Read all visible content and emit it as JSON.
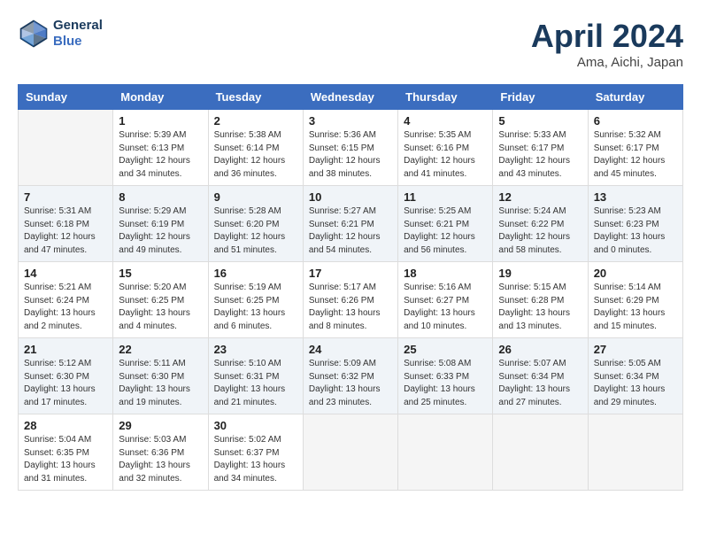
{
  "header": {
    "logo_line1": "General",
    "logo_line2": "Blue",
    "title": "April 2024",
    "location": "Ama, Aichi, Japan"
  },
  "weekdays": [
    "Sunday",
    "Monday",
    "Tuesday",
    "Wednesday",
    "Thursday",
    "Friday",
    "Saturday"
  ],
  "weeks": [
    [
      {
        "day": "",
        "sunrise": "",
        "sunset": "",
        "daylight": ""
      },
      {
        "day": "1",
        "sunrise": "Sunrise: 5:39 AM",
        "sunset": "Sunset: 6:13 PM",
        "daylight": "Daylight: 12 hours and 34 minutes."
      },
      {
        "day": "2",
        "sunrise": "Sunrise: 5:38 AM",
        "sunset": "Sunset: 6:14 PM",
        "daylight": "Daylight: 12 hours and 36 minutes."
      },
      {
        "day": "3",
        "sunrise": "Sunrise: 5:36 AM",
        "sunset": "Sunset: 6:15 PM",
        "daylight": "Daylight: 12 hours and 38 minutes."
      },
      {
        "day": "4",
        "sunrise": "Sunrise: 5:35 AM",
        "sunset": "Sunset: 6:16 PM",
        "daylight": "Daylight: 12 hours and 41 minutes."
      },
      {
        "day": "5",
        "sunrise": "Sunrise: 5:33 AM",
        "sunset": "Sunset: 6:17 PM",
        "daylight": "Daylight: 12 hours and 43 minutes."
      },
      {
        "day": "6",
        "sunrise": "Sunrise: 5:32 AM",
        "sunset": "Sunset: 6:17 PM",
        "daylight": "Daylight: 12 hours and 45 minutes."
      }
    ],
    [
      {
        "day": "7",
        "sunrise": "Sunrise: 5:31 AM",
        "sunset": "Sunset: 6:18 PM",
        "daylight": "Daylight: 12 hours and 47 minutes."
      },
      {
        "day": "8",
        "sunrise": "Sunrise: 5:29 AM",
        "sunset": "Sunset: 6:19 PM",
        "daylight": "Daylight: 12 hours and 49 minutes."
      },
      {
        "day": "9",
        "sunrise": "Sunrise: 5:28 AM",
        "sunset": "Sunset: 6:20 PM",
        "daylight": "Daylight: 12 hours and 51 minutes."
      },
      {
        "day": "10",
        "sunrise": "Sunrise: 5:27 AM",
        "sunset": "Sunset: 6:21 PM",
        "daylight": "Daylight: 12 hours and 54 minutes."
      },
      {
        "day": "11",
        "sunrise": "Sunrise: 5:25 AM",
        "sunset": "Sunset: 6:21 PM",
        "daylight": "Daylight: 12 hours and 56 minutes."
      },
      {
        "day": "12",
        "sunrise": "Sunrise: 5:24 AM",
        "sunset": "Sunset: 6:22 PM",
        "daylight": "Daylight: 12 hours and 58 minutes."
      },
      {
        "day": "13",
        "sunrise": "Sunrise: 5:23 AM",
        "sunset": "Sunset: 6:23 PM",
        "daylight": "Daylight: 13 hours and 0 minutes."
      }
    ],
    [
      {
        "day": "14",
        "sunrise": "Sunrise: 5:21 AM",
        "sunset": "Sunset: 6:24 PM",
        "daylight": "Daylight: 13 hours and 2 minutes."
      },
      {
        "day": "15",
        "sunrise": "Sunrise: 5:20 AM",
        "sunset": "Sunset: 6:25 PM",
        "daylight": "Daylight: 13 hours and 4 minutes."
      },
      {
        "day": "16",
        "sunrise": "Sunrise: 5:19 AM",
        "sunset": "Sunset: 6:25 PM",
        "daylight": "Daylight: 13 hours and 6 minutes."
      },
      {
        "day": "17",
        "sunrise": "Sunrise: 5:17 AM",
        "sunset": "Sunset: 6:26 PM",
        "daylight": "Daylight: 13 hours and 8 minutes."
      },
      {
        "day": "18",
        "sunrise": "Sunrise: 5:16 AM",
        "sunset": "Sunset: 6:27 PM",
        "daylight": "Daylight: 13 hours and 10 minutes."
      },
      {
        "day": "19",
        "sunrise": "Sunrise: 5:15 AM",
        "sunset": "Sunset: 6:28 PM",
        "daylight": "Daylight: 13 hours and 13 minutes."
      },
      {
        "day": "20",
        "sunrise": "Sunrise: 5:14 AM",
        "sunset": "Sunset: 6:29 PM",
        "daylight": "Daylight: 13 hours and 15 minutes."
      }
    ],
    [
      {
        "day": "21",
        "sunrise": "Sunrise: 5:12 AM",
        "sunset": "Sunset: 6:30 PM",
        "daylight": "Daylight: 13 hours and 17 minutes."
      },
      {
        "day": "22",
        "sunrise": "Sunrise: 5:11 AM",
        "sunset": "Sunset: 6:30 PM",
        "daylight": "Daylight: 13 hours and 19 minutes."
      },
      {
        "day": "23",
        "sunrise": "Sunrise: 5:10 AM",
        "sunset": "Sunset: 6:31 PM",
        "daylight": "Daylight: 13 hours and 21 minutes."
      },
      {
        "day": "24",
        "sunrise": "Sunrise: 5:09 AM",
        "sunset": "Sunset: 6:32 PM",
        "daylight": "Daylight: 13 hours and 23 minutes."
      },
      {
        "day": "25",
        "sunrise": "Sunrise: 5:08 AM",
        "sunset": "Sunset: 6:33 PM",
        "daylight": "Daylight: 13 hours and 25 minutes."
      },
      {
        "day": "26",
        "sunrise": "Sunrise: 5:07 AM",
        "sunset": "Sunset: 6:34 PM",
        "daylight": "Daylight: 13 hours and 27 minutes."
      },
      {
        "day": "27",
        "sunrise": "Sunrise: 5:05 AM",
        "sunset": "Sunset: 6:34 PM",
        "daylight": "Daylight: 13 hours and 29 minutes."
      }
    ],
    [
      {
        "day": "28",
        "sunrise": "Sunrise: 5:04 AM",
        "sunset": "Sunset: 6:35 PM",
        "daylight": "Daylight: 13 hours and 31 minutes."
      },
      {
        "day": "29",
        "sunrise": "Sunrise: 5:03 AM",
        "sunset": "Sunset: 6:36 PM",
        "daylight": "Daylight: 13 hours and 32 minutes."
      },
      {
        "day": "30",
        "sunrise": "Sunrise: 5:02 AM",
        "sunset": "Sunset: 6:37 PM",
        "daylight": "Daylight: 13 hours and 34 minutes."
      },
      {
        "day": "",
        "sunrise": "",
        "sunset": "",
        "daylight": ""
      },
      {
        "day": "",
        "sunrise": "",
        "sunset": "",
        "daylight": ""
      },
      {
        "day": "",
        "sunrise": "",
        "sunset": "",
        "daylight": ""
      },
      {
        "day": "",
        "sunrise": "",
        "sunset": "",
        "daylight": ""
      }
    ]
  ]
}
